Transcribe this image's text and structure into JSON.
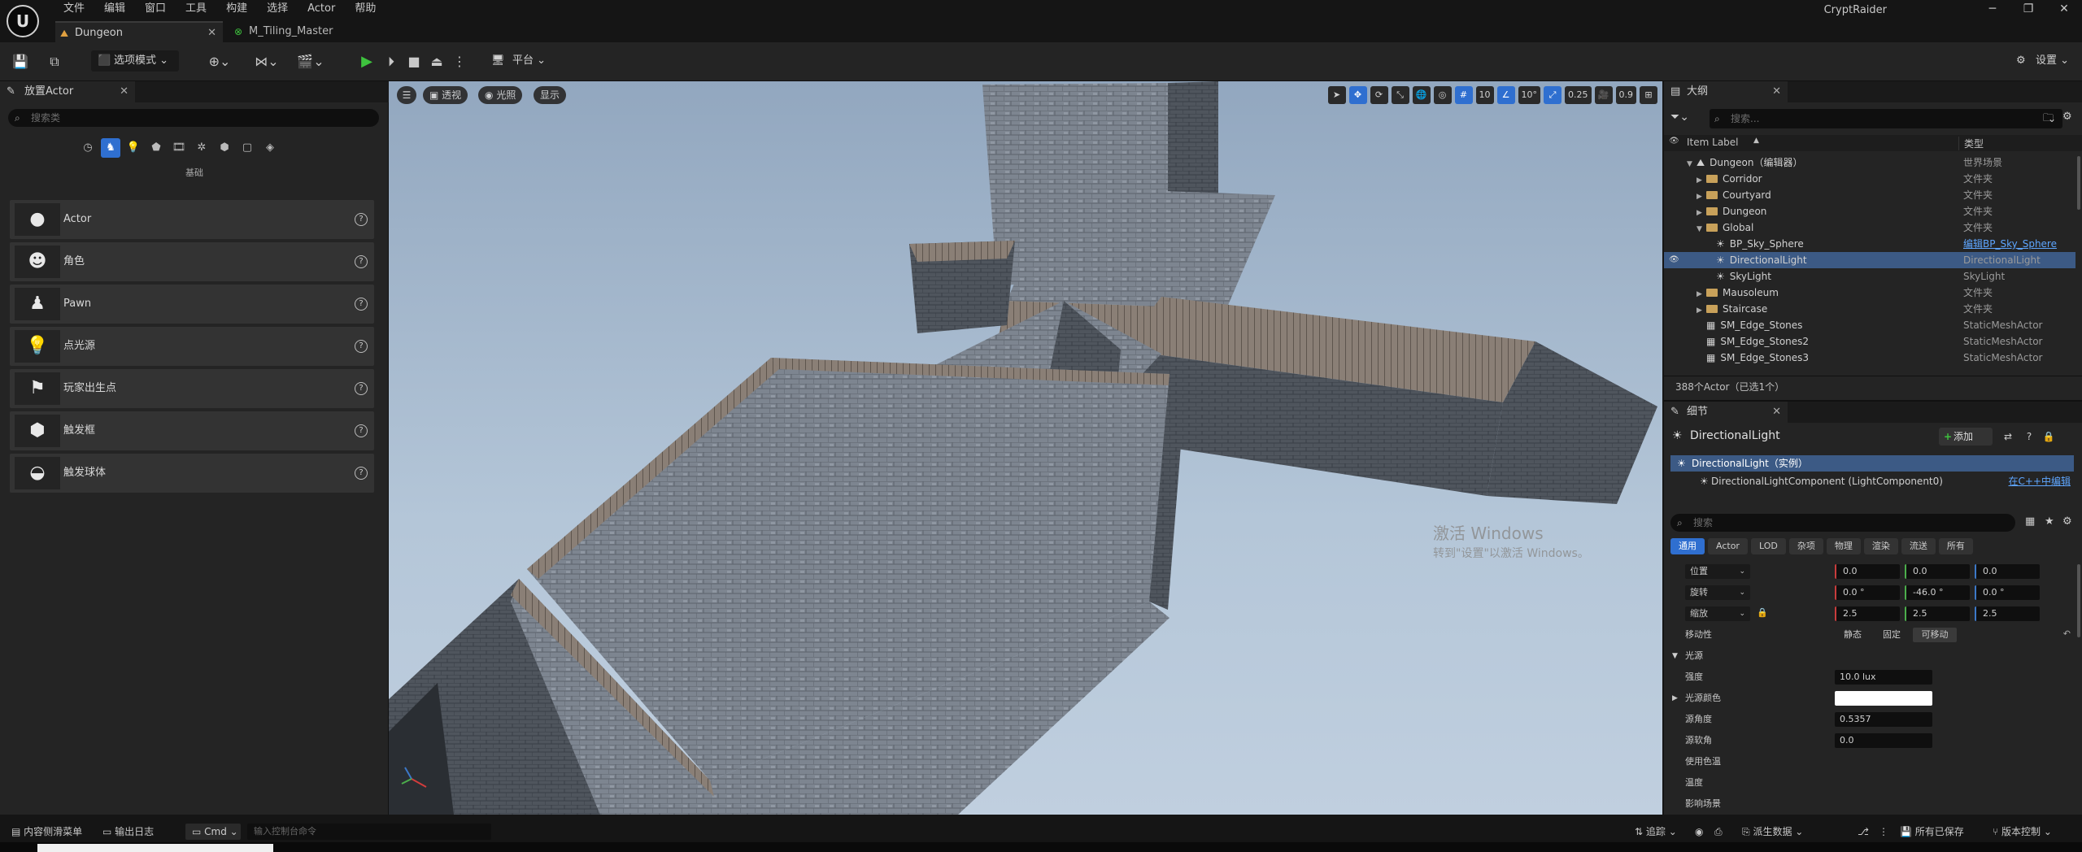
{
  "menus": [
    "文件",
    "编辑",
    "窗口",
    "工具",
    "构建",
    "选择",
    "Actor",
    "帮助"
  ],
  "app_name": "CryptRaider",
  "tabs": [
    {
      "label": "Dungeon"
    },
    {
      "label": "M_Tiling_Master"
    }
  ],
  "toolbar": {
    "mode_label": "选项模式",
    "platform_label": "平台",
    "settings_label": "设置"
  },
  "place_actors": {
    "tab_title": "放置Actor",
    "search_placeholder": "搜索类",
    "category_label": "基础",
    "items": [
      {
        "label": "Actor",
        "icon": "sphere-icon"
      },
      {
        "label": "角色",
        "icon": "character-icon"
      },
      {
        "label": "Pawn",
        "icon": "pawn-icon"
      },
      {
        "label": "点光源",
        "icon": "point-light-icon"
      },
      {
        "label": "玩家出生点",
        "icon": "player-start-icon"
      },
      {
        "label": "触发框",
        "icon": "trigger-box-icon"
      },
      {
        "label": "触发球体",
        "icon": "trigger-sphere-icon"
      }
    ]
  },
  "viewport": {
    "perspective": "透视",
    "lighting": "光照",
    "show": "显示",
    "grid_snap": "10",
    "rotation_snap": "10°",
    "scale_snap": "0.25",
    "camera_speed": "0.9",
    "watermark_title": "激活 Windows",
    "watermark_sub": "转到\"设置\"以激活 Windows。"
  },
  "outliner": {
    "tab_title": "大纲",
    "search_placeholder": "搜索...",
    "col_label": "Item Label",
    "col_type": "类型",
    "rows": [
      {
        "label": "Dungeon（编辑器）",
        "type": "世界场景",
        "indent": 1,
        "kind": "world"
      },
      {
        "label": "Corridor",
        "type": "文件夹",
        "indent": 2,
        "kind": "folder"
      },
      {
        "label": "Courtyard",
        "type": "文件夹",
        "indent": 2,
        "kind": "folder"
      },
      {
        "label": "Dungeon",
        "type": "文件夹",
        "indent": 2,
        "kind": "folder"
      },
      {
        "label": "Global",
        "type": "文件夹",
        "indent": 2,
        "kind": "folder-open"
      },
      {
        "label": "BP_Sky_Sphere",
        "type": "编辑BP_Sky_Sphere",
        "indent": 3,
        "kind": "actor",
        "link": true
      },
      {
        "label": "DirectionalLight",
        "type": "DirectionalLight",
        "indent": 3,
        "kind": "actor",
        "selected": true
      },
      {
        "label": "SkyLight",
        "type": "SkyLight",
        "indent": 3,
        "kind": "actor"
      },
      {
        "label": "Mausoleum",
        "type": "文件夹",
        "indent": 2,
        "kind": "folder"
      },
      {
        "label": "Staircase",
        "type": "文件夹",
        "indent": 2,
        "kind": "folder"
      },
      {
        "label": "SM_Edge_Stones",
        "type": "StaticMeshActor",
        "indent": 2,
        "kind": "mesh"
      },
      {
        "label": "SM_Edge_Stones2",
        "type": "StaticMeshActor",
        "indent": 2,
        "kind": "mesh"
      },
      {
        "label": "SM_Edge_Stones3",
        "type": "StaticMeshActor",
        "indent": 2,
        "kind": "mesh"
      }
    ],
    "status": "388个Actor（已选1个）"
  },
  "details": {
    "tab_title": "细节",
    "object_name": "DirectionalLight",
    "add_label": "添加",
    "instance_label": "DirectionalLight（实例）",
    "component_label": "DirectionalLightComponent (LightComponent0)",
    "edit_cpp": "在C++中编辑",
    "search_placeholder": "搜索",
    "filters": [
      "通用",
      "Actor",
      "LOD",
      "杂项",
      "物理",
      "渲染",
      "流送",
      "所有"
    ],
    "transform": [
      {
        "label": "位置",
        "x": "0.0",
        "y": "0.0",
        "z": "0.0"
      },
      {
        "label": "旋转",
        "x": "0.0 °",
        "y": "-46.0 °",
        "z": "0.0 °"
      },
      {
        "label": "缩放",
        "x": "2.5",
        "y": "2.5",
        "z": "2.5"
      }
    ],
    "mobility_label": "移动性",
    "mobility_options": [
      "静态",
      "固定",
      "可移动"
    ],
    "light_section": "光源",
    "props": [
      {
        "label": "强度",
        "value": "10.0 lux"
      },
      {
        "label": "光源颜色",
        "value": ""
      },
      {
        "label": "源角度",
        "value": "0.5357"
      },
      {
        "label": "源软角",
        "value": "0.0"
      },
      {
        "label": "使用色温",
        "value": ""
      },
      {
        "label": "温度",
        "value": ""
      },
      {
        "label": "影响场景",
        "value": ""
      }
    ]
  },
  "bottom": {
    "content_drawer": "内容侧滑菜单",
    "output_log": "输出日志",
    "cmd": "Cmd",
    "cmd_placeholder": "输入控制台命令",
    "trace": "追踪",
    "derived_data": "派生数据",
    "all_saved": "所有已保存",
    "source_control": "版本控制"
  }
}
